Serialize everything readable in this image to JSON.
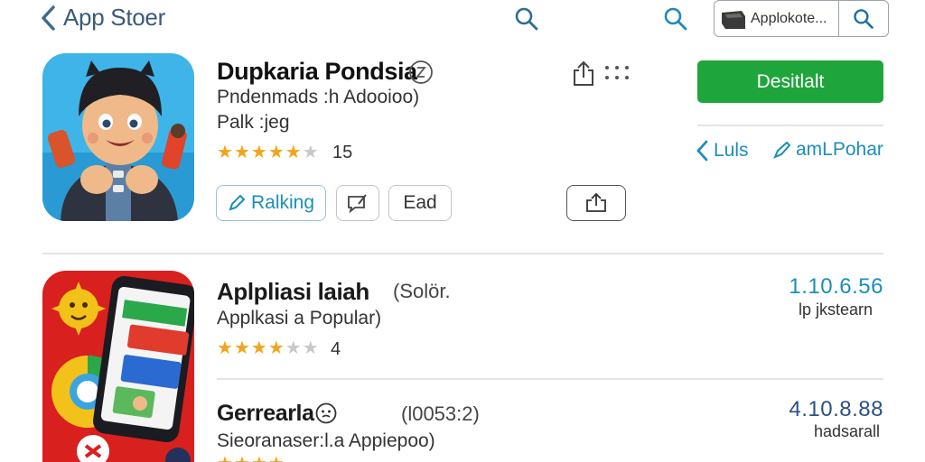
{
  "header": {
    "back_label": "App Stoer",
    "search_box_text": "Applokote...",
    "icons": [
      "chevron-left-icon",
      "search-icon",
      "search-icon",
      "store-icon",
      "search-icon"
    ]
  },
  "featured": {
    "name": "Dupkaria Pondsia",
    "subtitle": "Pndenmads :h Adooioo)",
    "category": "Palk :jeg",
    "rating": 4.5,
    "rating_count": "15",
    "open_button": "Desitlalt",
    "less_link": "Luls",
    "more_link": "amLPohar",
    "rank_button": "Ralking",
    "ead_button": "Ead",
    "colors": {
      "accent": "#1ea53c",
      "link": "#1a8fb8",
      "star": "#f2a51c"
    }
  },
  "apps": [
    {
      "name": "Aplpliasi laiah",
      "tag": "(Solör.",
      "subtitle": "Applkasi a Popular)",
      "rating": 3.5,
      "rating_count": "4",
      "version": "1.10.6.56",
      "version_note": "lp jkstearn"
    },
    {
      "name": "Gerrearla",
      "tag": "(l0053:2)",
      "subtitle": "Sieoranaser:l.a Appiepoo)",
      "version": "4.10.8.88",
      "version_note": "hadsarall"
    }
  ]
}
